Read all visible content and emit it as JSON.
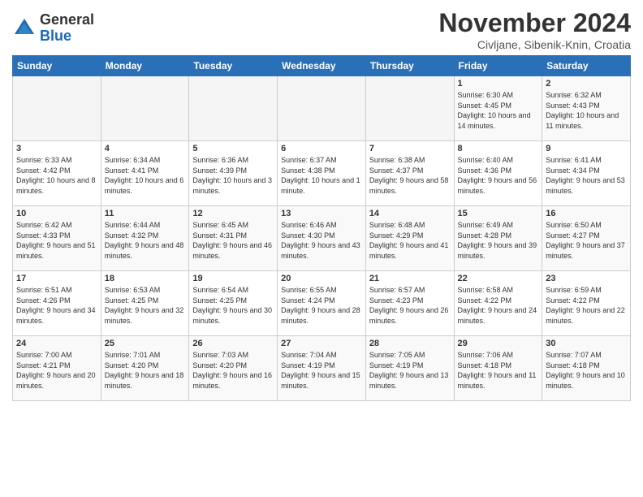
{
  "logo": {
    "general": "General",
    "blue": "Blue"
  },
  "title": "November 2024",
  "location": "Civljane, Sibenik-Knin, Croatia",
  "days_of_week": [
    "Sunday",
    "Monday",
    "Tuesday",
    "Wednesday",
    "Thursday",
    "Friday",
    "Saturday"
  ],
  "weeks": [
    [
      {
        "day": "",
        "info": ""
      },
      {
        "day": "",
        "info": ""
      },
      {
        "day": "",
        "info": ""
      },
      {
        "day": "",
        "info": ""
      },
      {
        "day": "",
        "info": ""
      },
      {
        "day": "1",
        "info": "Sunrise: 6:30 AM\nSunset: 4:45 PM\nDaylight: 10 hours and 14 minutes."
      },
      {
        "day": "2",
        "info": "Sunrise: 6:32 AM\nSunset: 4:43 PM\nDaylight: 10 hours and 11 minutes."
      }
    ],
    [
      {
        "day": "3",
        "info": "Sunrise: 6:33 AM\nSunset: 4:42 PM\nDaylight: 10 hours and 8 minutes."
      },
      {
        "day": "4",
        "info": "Sunrise: 6:34 AM\nSunset: 4:41 PM\nDaylight: 10 hours and 6 minutes."
      },
      {
        "day": "5",
        "info": "Sunrise: 6:36 AM\nSunset: 4:39 PM\nDaylight: 10 hours and 3 minutes."
      },
      {
        "day": "6",
        "info": "Sunrise: 6:37 AM\nSunset: 4:38 PM\nDaylight: 10 hours and 1 minute."
      },
      {
        "day": "7",
        "info": "Sunrise: 6:38 AM\nSunset: 4:37 PM\nDaylight: 9 hours and 58 minutes."
      },
      {
        "day": "8",
        "info": "Sunrise: 6:40 AM\nSunset: 4:36 PM\nDaylight: 9 hours and 56 minutes."
      },
      {
        "day": "9",
        "info": "Sunrise: 6:41 AM\nSunset: 4:34 PM\nDaylight: 9 hours and 53 minutes."
      }
    ],
    [
      {
        "day": "10",
        "info": "Sunrise: 6:42 AM\nSunset: 4:33 PM\nDaylight: 9 hours and 51 minutes."
      },
      {
        "day": "11",
        "info": "Sunrise: 6:44 AM\nSunset: 4:32 PM\nDaylight: 9 hours and 48 minutes."
      },
      {
        "day": "12",
        "info": "Sunrise: 6:45 AM\nSunset: 4:31 PM\nDaylight: 9 hours and 46 minutes."
      },
      {
        "day": "13",
        "info": "Sunrise: 6:46 AM\nSunset: 4:30 PM\nDaylight: 9 hours and 43 minutes."
      },
      {
        "day": "14",
        "info": "Sunrise: 6:48 AM\nSunset: 4:29 PM\nDaylight: 9 hours and 41 minutes."
      },
      {
        "day": "15",
        "info": "Sunrise: 6:49 AM\nSunset: 4:28 PM\nDaylight: 9 hours and 39 minutes."
      },
      {
        "day": "16",
        "info": "Sunrise: 6:50 AM\nSunset: 4:27 PM\nDaylight: 9 hours and 37 minutes."
      }
    ],
    [
      {
        "day": "17",
        "info": "Sunrise: 6:51 AM\nSunset: 4:26 PM\nDaylight: 9 hours and 34 minutes."
      },
      {
        "day": "18",
        "info": "Sunrise: 6:53 AM\nSunset: 4:25 PM\nDaylight: 9 hours and 32 minutes."
      },
      {
        "day": "19",
        "info": "Sunrise: 6:54 AM\nSunset: 4:25 PM\nDaylight: 9 hours and 30 minutes."
      },
      {
        "day": "20",
        "info": "Sunrise: 6:55 AM\nSunset: 4:24 PM\nDaylight: 9 hours and 28 minutes."
      },
      {
        "day": "21",
        "info": "Sunrise: 6:57 AM\nSunset: 4:23 PM\nDaylight: 9 hours and 26 minutes."
      },
      {
        "day": "22",
        "info": "Sunrise: 6:58 AM\nSunset: 4:22 PM\nDaylight: 9 hours and 24 minutes."
      },
      {
        "day": "23",
        "info": "Sunrise: 6:59 AM\nSunset: 4:22 PM\nDaylight: 9 hours and 22 minutes."
      }
    ],
    [
      {
        "day": "24",
        "info": "Sunrise: 7:00 AM\nSunset: 4:21 PM\nDaylight: 9 hours and 20 minutes."
      },
      {
        "day": "25",
        "info": "Sunrise: 7:01 AM\nSunset: 4:20 PM\nDaylight: 9 hours and 18 minutes."
      },
      {
        "day": "26",
        "info": "Sunrise: 7:03 AM\nSunset: 4:20 PM\nDaylight: 9 hours and 16 minutes."
      },
      {
        "day": "27",
        "info": "Sunrise: 7:04 AM\nSunset: 4:19 PM\nDaylight: 9 hours and 15 minutes."
      },
      {
        "day": "28",
        "info": "Sunrise: 7:05 AM\nSunset: 4:19 PM\nDaylight: 9 hours and 13 minutes."
      },
      {
        "day": "29",
        "info": "Sunrise: 7:06 AM\nSunset: 4:18 PM\nDaylight: 9 hours and 11 minutes."
      },
      {
        "day": "30",
        "info": "Sunrise: 7:07 AM\nSunset: 4:18 PM\nDaylight: 9 hours and 10 minutes."
      }
    ]
  ]
}
